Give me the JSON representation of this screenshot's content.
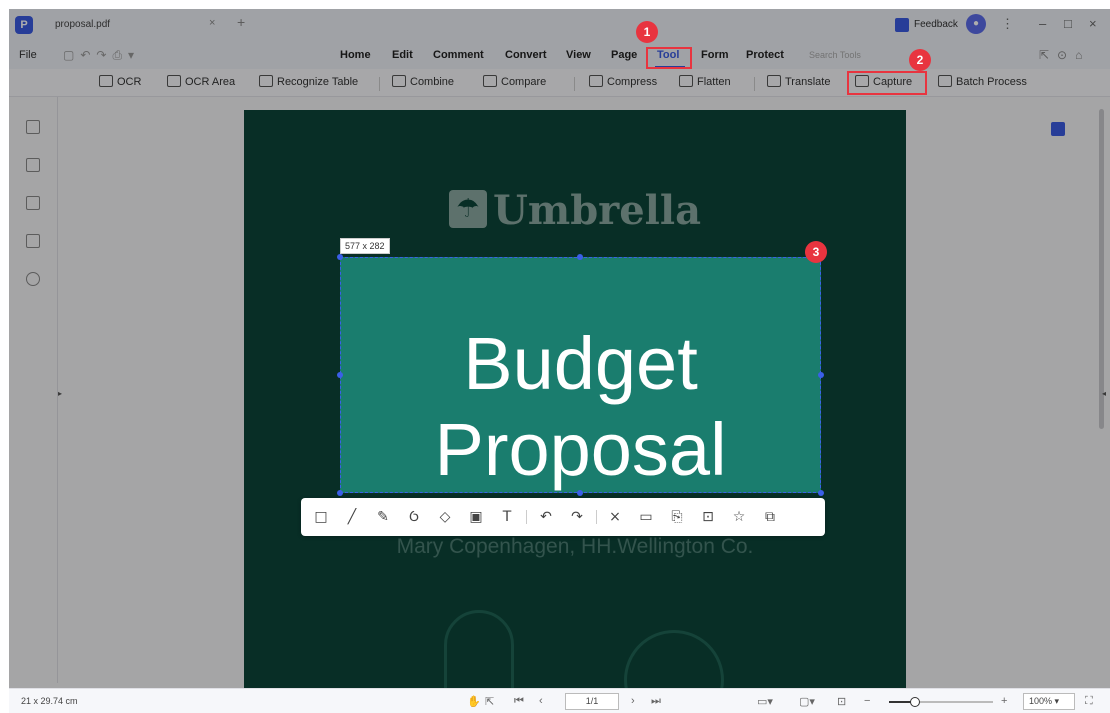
{
  "window": {
    "tab_title": "proposal.pdf",
    "feedback_label": "Feedback"
  },
  "menu": {
    "file": "File",
    "items": [
      "Home",
      "Edit",
      "Comment",
      "Convert",
      "View",
      "Page",
      "Tool",
      "Form",
      "Protect"
    ],
    "active": "Tool",
    "search_placeholder": "Search Tools"
  },
  "ribbon": {
    "tools": [
      "OCR",
      "OCR Area",
      "Recognize Table",
      "Combine",
      "Compare",
      "Compress",
      "Flatten",
      "Translate",
      "Capture",
      "Batch Process"
    ]
  },
  "document": {
    "brand": "Umbrella",
    "title_line1": "Budget",
    "title_line2": "Proposal",
    "subtitle": "Mary Copenhagen, HH.Wellington Co."
  },
  "capture": {
    "size_label": "577 x 282"
  },
  "annotation_toolbar": {
    "icons": [
      "rectangle-icon",
      "line-icon",
      "pencil-icon",
      "highlighter-icon",
      "eraser-icon",
      "mosaic-icon",
      "text-icon",
      "undo-icon",
      "redo-icon",
      "close-icon",
      "save-icon",
      "copy-text-icon",
      "export-icon",
      "pin-icon",
      "copy-icon"
    ]
  },
  "markers": [
    "1",
    "2",
    "3"
  ],
  "status": {
    "page_size": "21 x 29.74 cm",
    "page_indicator": "1/1",
    "zoom": "100%"
  },
  "colors": {
    "accent": "#3a5ae0",
    "marker": "#e8343f",
    "page_bg": "#0d4438",
    "highlight_bg": "#1a7d6e"
  }
}
